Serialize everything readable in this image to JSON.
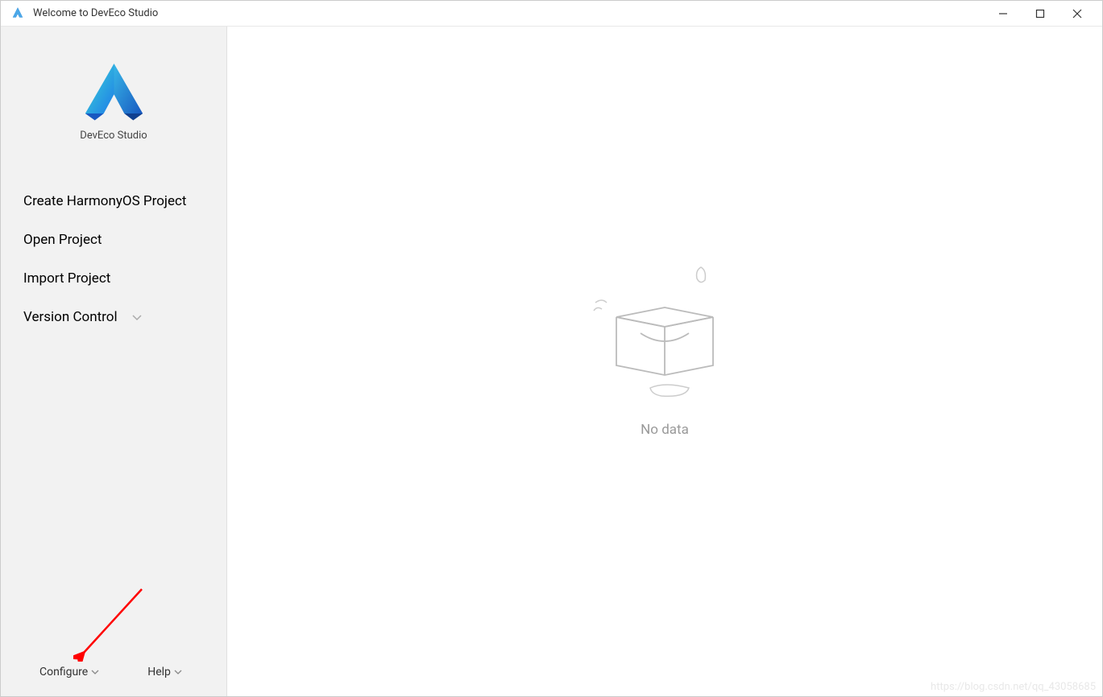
{
  "titlebar": {
    "title": "Welcome to DevEco Studio"
  },
  "sidebar": {
    "logo_text": "DevEco Studio",
    "menu_items": [
      {
        "label": "Create HarmonyOS Project",
        "has_chevron": false
      },
      {
        "label": "Open Project",
        "has_chevron": false
      },
      {
        "label": "Import Project",
        "has_chevron": false
      },
      {
        "label": "Version Control",
        "has_chevron": true
      }
    ],
    "footer": {
      "configure": "Configure",
      "help": "Help"
    }
  },
  "main": {
    "empty_text": "No data"
  },
  "watermark": "https://blog.csdn.net/qq_43058685"
}
